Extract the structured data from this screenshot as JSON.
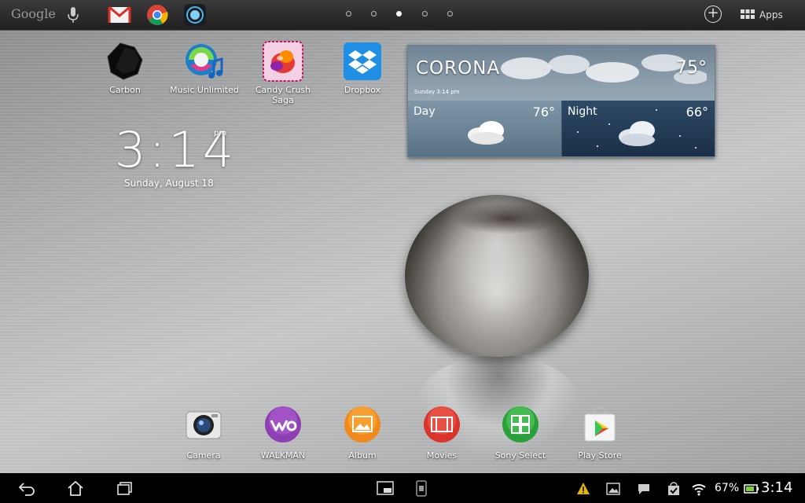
{
  "topbar": {
    "search_label": "Google",
    "apps_label": "Apps",
    "page_count": 5,
    "active_page": 2
  },
  "shortcuts": [
    {
      "label": "Carbon",
      "icon": "carbon-icon"
    },
    {
      "label": "Music Unlimited",
      "icon": "music-unlimited-icon"
    },
    {
      "label": "Candy Crush Saga",
      "icon": "candy-crush-icon"
    },
    {
      "label": "Dropbox",
      "icon": "dropbox-icon"
    }
  ],
  "clock": {
    "time": "3:14",
    "ampm": "pm",
    "date": "Sunday, August 18"
  },
  "weather": {
    "city": "CORONA",
    "current_temp": "75°",
    "updated": "Sunday 3:14 pm",
    "day_label": "Day",
    "day_temp": "76°",
    "night_label": "Night",
    "night_temp": "66°"
  },
  "dock": [
    {
      "label": "Camera",
      "icon": "camera-icon"
    },
    {
      "label": "WALKMAN",
      "icon": "walkman-icon"
    },
    {
      "label": "Album",
      "icon": "album-icon"
    },
    {
      "label": "Movies",
      "icon": "movies-icon"
    },
    {
      "label": "Sony Select",
      "icon": "sony-select-icon"
    },
    {
      "label": "Play Store",
      "icon": "play-store-icon"
    }
  ],
  "statusbar": {
    "battery_percent": "67%",
    "time": "3:14"
  },
  "colors": {
    "topbar_bg": "#2a2a2a",
    "navbar_bg": "#000000",
    "battery_fill": "#7cd13a",
    "dropbox_blue": "#1f8fe6",
    "warning": "#e6b500"
  }
}
